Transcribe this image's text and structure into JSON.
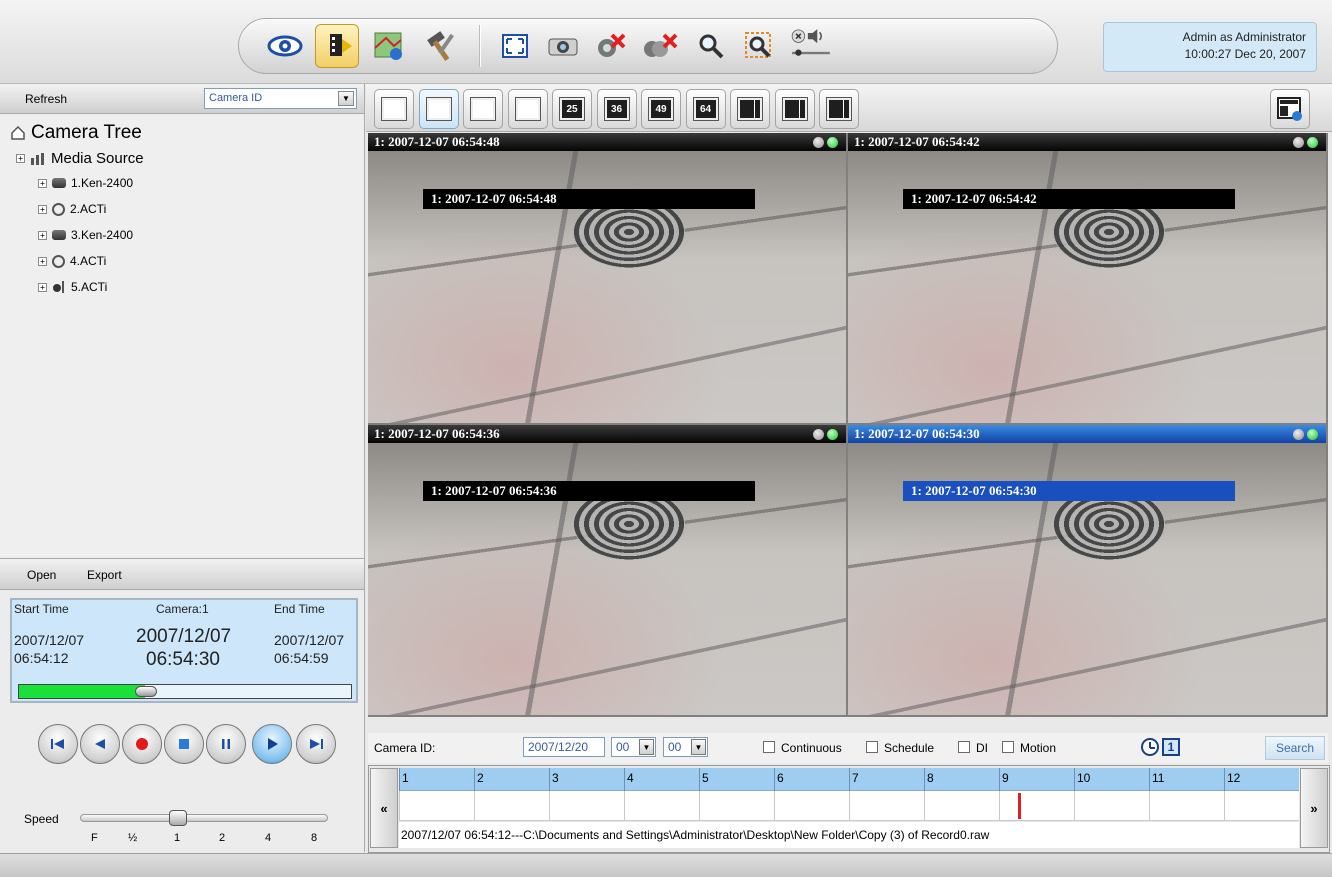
{
  "header": {
    "user": "Admin as Administrator",
    "datetime": "10:00:27 Dec 20, 2007",
    "tools": [
      {
        "icon": "eye-icon",
        "selected": false
      },
      {
        "icon": "playback-tape-icon",
        "selected": true
      },
      {
        "icon": "map-icon",
        "selected": false
      },
      {
        "icon": "hammer-tools-icon",
        "selected": false
      },
      {
        "icon": "fullscreen-icon",
        "selected": false
      },
      {
        "icon": "snapshot-camera-icon",
        "selected": false
      },
      {
        "icon": "disconnect-camera-icon",
        "selected": false
      },
      {
        "icon": "disconnect-all-icon",
        "selected": false
      },
      {
        "icon": "zoom-icon",
        "selected": false
      },
      {
        "icon": "digital-zoom-icon",
        "selected": false
      },
      {
        "icon": "audio-volume-icon",
        "selected": false
      }
    ]
  },
  "camera_tree": {
    "refresh_label": "Refresh",
    "sort_selected": "Camera ID",
    "root_label": "Camera Tree",
    "media_source_label": "Media Source",
    "cameras": [
      {
        "label": "1.Ken-2400",
        "icon": "box-camera-icon"
      },
      {
        "label": "2.ACTi",
        "icon": "dome-camera-icon"
      },
      {
        "label": "3.Ken-2400",
        "icon": "box-camera-icon"
      },
      {
        "label": "4.ACTi",
        "icon": "dome-camera-icon"
      },
      {
        "label": "5.ACTi",
        "icon": "speed-dome-icon"
      }
    ]
  },
  "playback": {
    "open_label": "Open",
    "export_label": "Export",
    "start_time_label": "Start Time",
    "camera_label": "Camera:1",
    "end_time_label": "End Time",
    "start_date": "2007/12/07",
    "start_time": "06:54:12",
    "current_date": "2007/12/07",
    "current_time": "06:54:30",
    "end_date": "2007/12/07",
    "end_time": "06:54:59",
    "progress": 0.38,
    "controls": [
      "skip-start-icon",
      "rewind-icon",
      "record-icon",
      "stop-icon",
      "pause-icon",
      "play-icon",
      "skip-end-icon"
    ],
    "speed_label": "Speed",
    "speed_ticks": [
      "F",
      "½",
      "1",
      "2",
      "4",
      "8"
    ],
    "speed_value": "1"
  },
  "layouts": [
    {
      "icon": "layout-1-icon",
      "text": "",
      "selected": false
    },
    {
      "icon": "layout-4-icon",
      "text": "",
      "selected": true
    },
    {
      "icon": "layout-9-icon",
      "text": "",
      "selected": false
    },
    {
      "icon": "layout-16-icon",
      "text": "",
      "selected": false
    },
    {
      "icon": "layout-25-icon",
      "text": "25",
      "selected": false
    },
    {
      "icon": "layout-36-icon",
      "text": "36",
      "selected": false
    },
    {
      "icon": "layout-49-icon",
      "text": "49",
      "selected": false
    },
    {
      "icon": "layout-64-icon",
      "text": "64",
      "selected": false
    },
    {
      "icon": "layout-custom-a-icon",
      "text": "",
      "selected": false
    },
    {
      "icon": "layout-custom-b-icon",
      "text": "",
      "selected": false
    },
    {
      "icon": "layout-custom-c-icon",
      "text": "",
      "selected": false
    }
  ],
  "layout_config_icon": "layout-settings-icon",
  "tiles": [
    {
      "title": "1:  2007-12-07 06:54:48",
      "overlay": "1:  2007-12-07 06:54:48",
      "active": false
    },
    {
      "title": "1:  2007-12-07 06:54:42",
      "overlay": "1:  2007-12-07 06:54:42",
      "active": false
    },
    {
      "title": "1:  2007-12-07 06:54:36",
      "overlay": "1:  2007-12-07 06:54:36",
      "active": false
    },
    {
      "title": "1:  2007-12-07 06:54:30",
      "overlay": "1:  2007-12-07 06:54:30",
      "active": true
    }
  ],
  "search": {
    "camera_id_label": "Camera ID:",
    "date_value": "2007/12/20",
    "hour_value": "00",
    "minute_value": "00",
    "checkboxes": [
      {
        "label": "Continuous",
        "checked": false
      },
      {
        "label": "Schedule",
        "checked": false
      },
      {
        "label": "DI",
        "checked": false
      },
      {
        "label": "Motion",
        "checked": false
      }
    ],
    "clock_icon": "clock-icon",
    "one_icon": "1",
    "search_label": "Search"
  },
  "timeline": {
    "hours": [
      "1",
      "2",
      "3",
      "4",
      "5",
      "6",
      "7",
      "8",
      "9",
      "10",
      "11",
      "12"
    ],
    "marker_hour": 9.25,
    "record_path": "2007/12/07 06:54:12---C:\\Documents and Settings\\Administrator\\Desktop\\New Folder\\Copy (3) of Record0.raw",
    "prev_label": "«",
    "next_label": "»"
  }
}
